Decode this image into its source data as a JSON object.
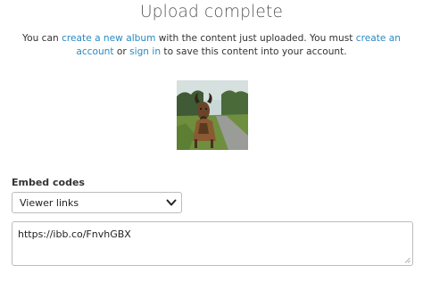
{
  "header": {
    "title": "Upload complete"
  },
  "message": {
    "part1": "You can ",
    "link_album": "create a new album",
    "part2": " with the content just uploaded. You must ",
    "link_account": "create an account",
    "part3": " or ",
    "link_signin": "sign in",
    "part4": " to save this content into your account."
  },
  "thumbnail": {
    "icon": "uploaded-image-goat",
    "colors": {
      "sky": "#c9d7d6",
      "trees": "#3f5a34",
      "grass": "#6f8f3e",
      "path": "#9a9c97",
      "goat": "#8a5a32"
    }
  },
  "embed": {
    "label": "Embed codes",
    "selected_option": "Viewer links",
    "code_value": "https://ibb.co/FnvhGBX"
  },
  "colors": {
    "link": "#2a88c5",
    "text": "#333333",
    "border": "#bcbcbc"
  }
}
